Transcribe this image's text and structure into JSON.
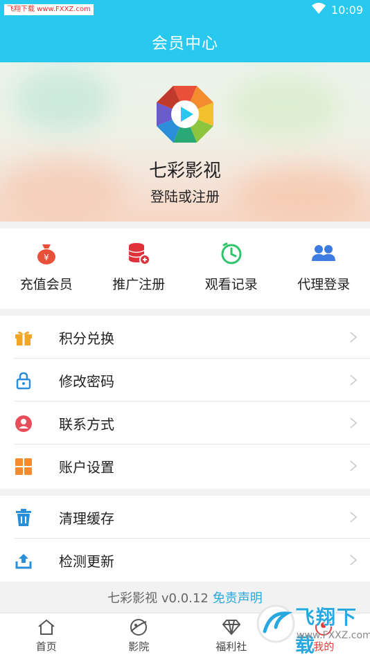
{
  "status_bar": {
    "watermark": "飞翔下载 www.FXXZ.com",
    "time": "10:09"
  },
  "header": {
    "title": "会员中心"
  },
  "hero": {
    "app_name": "七彩影视",
    "login_text": "登陆或注册"
  },
  "quick_actions": [
    {
      "label": "充值会员",
      "icon": "money-bag-icon",
      "color": "#e8503a"
    },
    {
      "label": "推广注册",
      "icon": "database-add-icon",
      "color": "#e0303a"
    },
    {
      "label": "观看记录",
      "icon": "clock-icon",
      "color": "#2fc46b"
    },
    {
      "label": "代理登录",
      "icon": "users-icon",
      "color": "#3d7be0"
    }
  ],
  "menu_group_1": [
    {
      "label": "积分兑换",
      "icon": "gift-icon",
      "color": "#f2a623"
    },
    {
      "label": "修改密码",
      "icon": "lock-icon",
      "color": "#2a8fd8"
    },
    {
      "label": "联系方式",
      "icon": "contact-icon",
      "color": "#e84d5b"
    },
    {
      "label": "账户设置",
      "icon": "grid-icon",
      "color": "#f28c2e"
    }
  ],
  "menu_group_2": [
    {
      "label": "清理缓存",
      "icon": "trash-icon",
      "color": "#2a8fd8"
    },
    {
      "label": "检测更新",
      "icon": "upload-icon",
      "color": "#2a8fd8"
    }
  ],
  "footer": {
    "version": "七彩影视 v0.0.12",
    "disclaimer": "免责声明"
  },
  "bottom_nav": [
    {
      "label": "首页",
      "icon": "home-icon"
    },
    {
      "label": "影院",
      "icon": "planet-icon"
    },
    {
      "label": "福利社",
      "icon": "diamond-icon"
    },
    {
      "label": "我的",
      "icon": "profile-icon"
    }
  ],
  "overlay_watermark": {
    "text": "飞翔下载",
    "url": "www.FXXZ.com"
  }
}
